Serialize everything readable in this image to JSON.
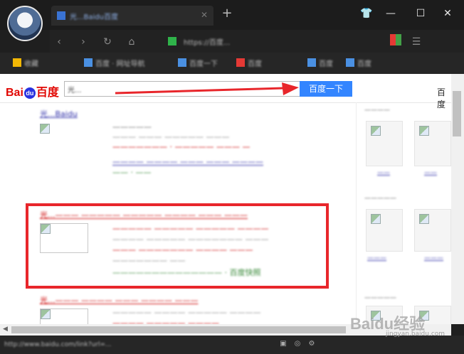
{
  "browser": {
    "tab_title": "光...Baidu百度",
    "tab_close": "✕",
    "new_tab": "+",
    "window_buttons": {
      "skin": "👕",
      "minimize": "—",
      "maximize": "☐",
      "close": "✕"
    },
    "nav": {
      "back": "‹",
      "forward": "›",
      "refresh": "↻",
      "home": "⌂"
    },
    "url_label": "https://百度...",
    "bookmarks": [
      {
        "label": "收藏",
        "color": "#f2b705"
      },
      {
        "label": "百度 · 网址导航",
        "color": "#4a90e2"
      },
      {
        "label": "百度一下",
        "color": "#4a90e2"
      },
      {
        "label": "百度",
        "color": "#e53935"
      },
      {
        "label": "百度",
        "color": "#4a90e2"
      },
      {
        "label": "百度",
        "color": "#4a90e2"
      }
    ]
  },
  "search": {
    "logo_bai": "Bai",
    "logo_du": "du",
    "logo_cn": "百度",
    "query": "光...",
    "button": "百度一下",
    "top_link": "百度"
  },
  "results": [
    {
      "title": "光...Baidu",
      "lines": [
        "—————",
        "——— ——— ————— ———",
        "——————— · ————— ——— —",
        "———— ———— ——— ——— ————"
      ],
      "url": "—— · ——"
    },
    {
      "title": "光...——— ————— ————— ———— ——— ———",
      "lines": [
        "————— ————— ————— ————",
        "———— ————— ——————— ———",
        "——— ——————— ———— ———",
        "——————— ——"
      ],
      "url": "—————————————— · 百度快照"
    },
    {
      "title": "光...——— ———— ——— ———— ———",
      "lines": [
        "————— ———— ————— ————",
        "———— ————— ————"
      ],
      "url": ""
    }
  ],
  "right_column": {
    "section1": "————",
    "section2": "—————",
    "section3": "—————",
    "captions": [
      "——",
      "——",
      "———",
      "———"
    ]
  },
  "status_text": "http://www.baidu.com/link?url=...",
  "watermark": "Baidu经验",
  "watermark_url": "jingyan.baidu.com",
  "colors": {
    "accent": "#3385ff",
    "highlight": "#e8262b",
    "arrow": "#e8262b"
  }
}
